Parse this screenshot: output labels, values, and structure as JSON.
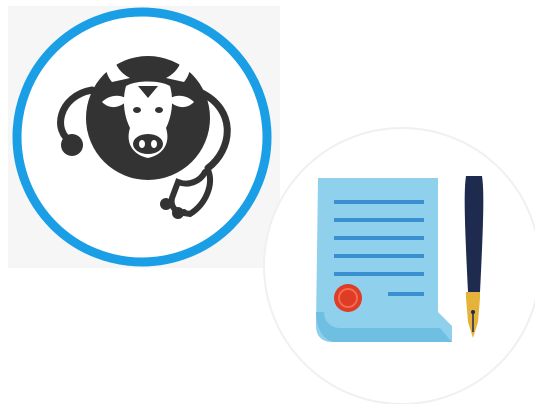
{
  "colors": {
    "vet_ring": "#1a9ee6",
    "vet_icon": "#333333",
    "document_paper": "#8fd0ec",
    "document_lines": "#3a8fd0",
    "seal": "#e03b24",
    "pen_barrel": "#1e2a4e",
    "pen_gold": "#e6b33a"
  },
  "icons": [
    "veterinary-cow-stethoscope-icon",
    "document-with-seal-icon",
    "fountain-pen-icon"
  ]
}
